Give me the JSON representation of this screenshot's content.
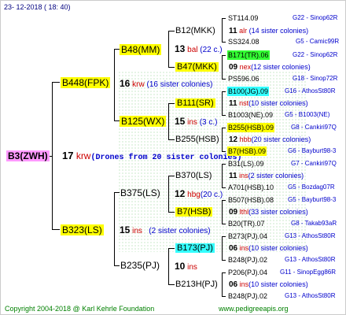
{
  "header": {
    "date": "23- 12-2018 ( 18: 40)"
  },
  "footer": {
    "copyright": "Copyright 2004-2018 @ Karl Kehrle Foundation",
    "site": "www.pedigreeapis.org"
  },
  "root": {
    "id": "B3(ZWH)"
  },
  "gen0": {
    "num": "17",
    "code": "krw",
    "note": "(Drones from 20 sister colonies)"
  },
  "b448": {
    "id": "B448(FPK)",
    "num": "16",
    "code": "krw",
    "note": "(16 sister colonies)"
  },
  "b323": {
    "id": "B323(LS)",
    "num": "15",
    "code": "ins",
    "note": "(2 sister colonies)"
  },
  "b48": {
    "id": "B48(MM)",
    "num": "13",
    "code": "bal",
    "note": "(22 c.)"
  },
  "b125": {
    "id": "B125(WX)",
    "num": "15",
    "code": "ins",
    "note": "(3 c.)"
  },
  "b375": {
    "id": "B375(LS)",
    "num": "12",
    "code": "hbg",
    "note": "(20 c.)"
  },
  "b235": {
    "id": "B235(PJ)",
    "num": "10",
    "code": "ins"
  },
  "b12": {
    "id": "B12(MKK)",
    "num": "11",
    "code": "alr",
    "note": "(14 sister colonies)"
  },
  "b47": {
    "id": "B47(MKK)",
    "num": "09",
    "code": "nex",
    "note": "(12 sister colonies)"
  },
  "b111": {
    "id": "B111(SR)",
    "num": "11",
    "code": "nst",
    "note": "(10 sister colonies)"
  },
  "b255": {
    "id": "B255(HSB)",
    "num": "12",
    "code": "hbb",
    "note": "(20 sister colonies)"
  },
  "b370": {
    "id": "B370(LS)",
    "num": "11",
    "code": "ins",
    "note": "(2 sister colonies)"
  },
  "b7": {
    "id": "B7(HSB)",
    "num": "09",
    "code": "lthl",
    "note": "(33 sister colonies)"
  },
  "b173": {
    "id": "B173(PJ)",
    "num": "06",
    "code": "ins",
    "note": "(10 sister colonies)"
  },
  "b213": {
    "id": "B213H(PJ)",
    "num": "06",
    "code": "ins",
    "note": "(10 sister colonies)"
  },
  "leaves": [
    {
      "id": "ST114.09",
      "src": "G22 - Sinop62R"
    },
    {
      "id": "SS324.08",
      "src": "G5 - Camic99R"
    },
    {
      "id": "B171(TR).06",
      "src": "G22 - Sinop62R"
    },
    {
      "id": "PS596.06",
      "src": "G18 - Sinop72R"
    },
    {
      "id": "B100(JG).09",
      "src": "G16 - AthosSt80R"
    },
    {
      "id": "B1003(NE).09",
      "src": "G5 - B1003(NE)"
    },
    {
      "id": "B255(HSB).09",
      "src": "G8 - Cankiri97Q"
    },
    {
      "id": "B7(HSB).09",
      "src": "G6 - Bayburt98-3"
    },
    {
      "id": "B31(LS).09",
      "src": "G7 - Cankiri97Q"
    },
    {
      "id": "A701(HSB).10",
      "src": "G5 - Bozdag07R"
    },
    {
      "id": "B507(HSB).08",
      "src": "G5 - Bayburt98-3"
    },
    {
      "id": "B20(TR).07",
      "src": "G8 - Takab93aR"
    },
    {
      "id": "B273(PJ).04",
      "src": "G13 - AthosSt80R"
    },
    {
      "id": "B248(PJ).02",
      "src": "G13 - AthosSt80R"
    },
    {
      "id": "P206(PJ).04",
      "src": "G11 - SinopEgg86R"
    },
    {
      "id": "B248(PJ).02",
      "src": "G13 - AthosSt80R"
    }
  ],
  "colors": {
    "yellow": "#ffff00",
    "pink": "#ff99ff",
    "green": "#33ff33",
    "cyan": "#33ffff",
    "red": "#cc0000",
    "blue": "#0000cc",
    "footerGreen": "#008000"
  }
}
